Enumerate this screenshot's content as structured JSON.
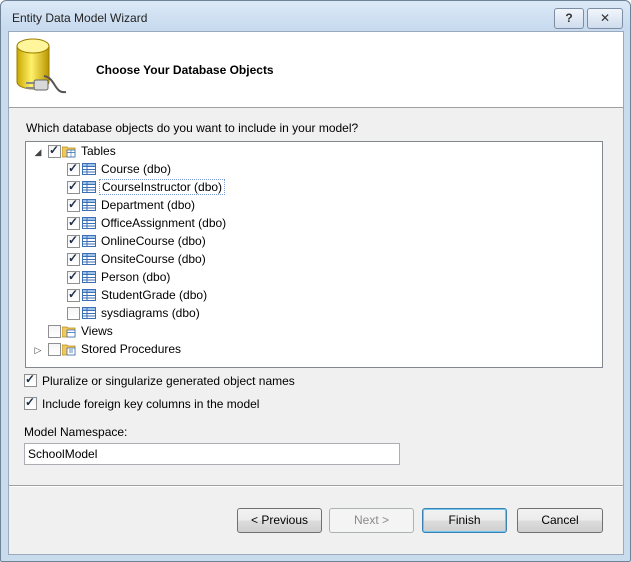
{
  "window": {
    "title": "Entity Data Model Wizard",
    "help_label": "?",
    "close_label": "✕"
  },
  "header": {
    "title": "Choose Your Database Objects"
  },
  "question": "Which database objects do you want to include in your model?",
  "tree": {
    "groups": [
      {
        "label": "Tables",
        "expanded": true,
        "checked": true
      },
      {
        "label": "Views",
        "expanded": false,
        "checked": false
      },
      {
        "label": "Stored Procedures",
        "expanded": false,
        "checked": false
      }
    ],
    "tables": [
      {
        "label": "Course (dbo)",
        "checked": true
      },
      {
        "label": "CourseInstructor (dbo)",
        "checked": true
      },
      {
        "label": "Department (dbo)",
        "checked": true
      },
      {
        "label": "OfficeAssignment (dbo)",
        "checked": true
      },
      {
        "label": "OnlineCourse (dbo)",
        "checked": true
      },
      {
        "label": "OnsiteCourse (dbo)",
        "checked": true
      },
      {
        "label": "Person (dbo)",
        "checked": true
      },
      {
        "label": "StudentGrade (dbo)",
        "checked": true
      },
      {
        "label": "sysdiagrams (dbo)",
        "checked": false
      }
    ]
  },
  "options": {
    "pluralize": {
      "label": "Pluralize or singularize generated object names",
      "checked": true
    },
    "foreign_keys": {
      "label": "Include foreign key columns in the model",
      "checked": true
    }
  },
  "namespace": {
    "label": "Model Namespace:",
    "value": "SchoolModel"
  },
  "buttons": {
    "previous": "< Previous",
    "next": "Next >",
    "finish": "Finish",
    "cancel": "Cancel"
  }
}
